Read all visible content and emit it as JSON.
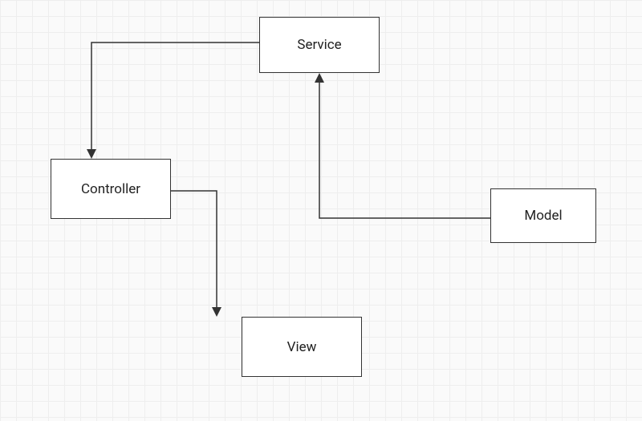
{
  "nodes": {
    "service": {
      "label": "Service"
    },
    "controller": {
      "label": "Controller"
    },
    "model": {
      "label": "Model"
    },
    "view": {
      "label": "View"
    }
  },
  "edges": [
    {
      "from": "service",
      "to": "controller"
    },
    {
      "from": "controller",
      "to": "view"
    },
    {
      "from": "model",
      "to": "service"
    }
  ]
}
